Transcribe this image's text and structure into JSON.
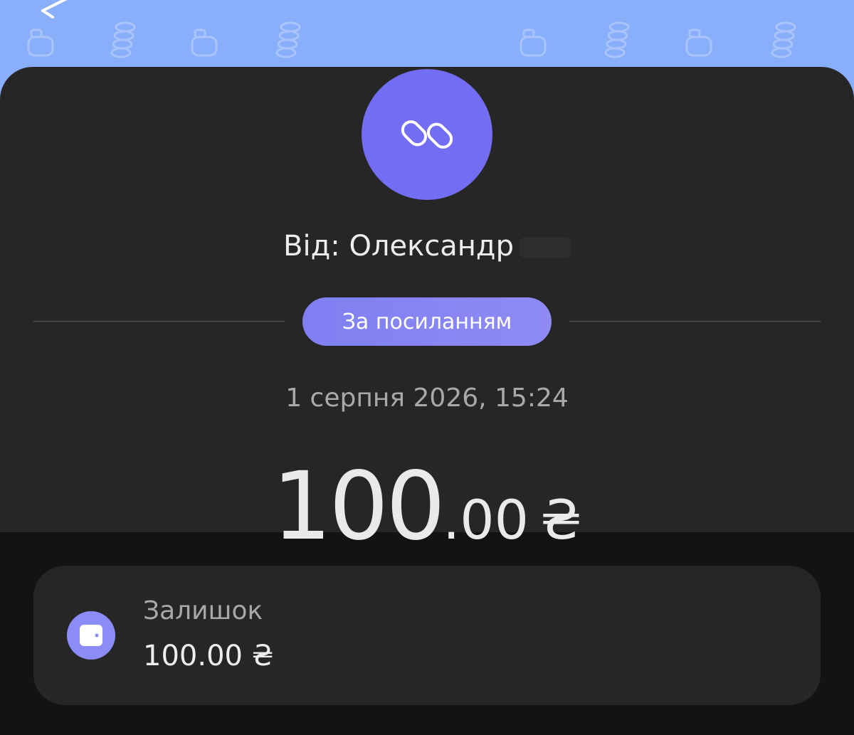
{
  "transaction": {
    "sender_prefix": "Від: ",
    "sender_name": "Олександр",
    "tag": "За посиланням",
    "date": "1 серпня 2026, 15:24",
    "amount_integer": "100",
    "amount_decimal": ".00",
    "currency": "₴"
  },
  "balance": {
    "label": "Залишок",
    "value": "100.00 ₴"
  },
  "icons": {
    "back": "arrow-left-icon",
    "avatar": "link-icon",
    "wallet": "wallet-icon",
    "pattern": "piggy-bank-and-coins-icons"
  },
  "colors": {
    "header_band": "#89aefa",
    "avatar": "#726df2",
    "tag": "#8585f3",
    "card": "#262626",
    "background": "#131313"
  }
}
